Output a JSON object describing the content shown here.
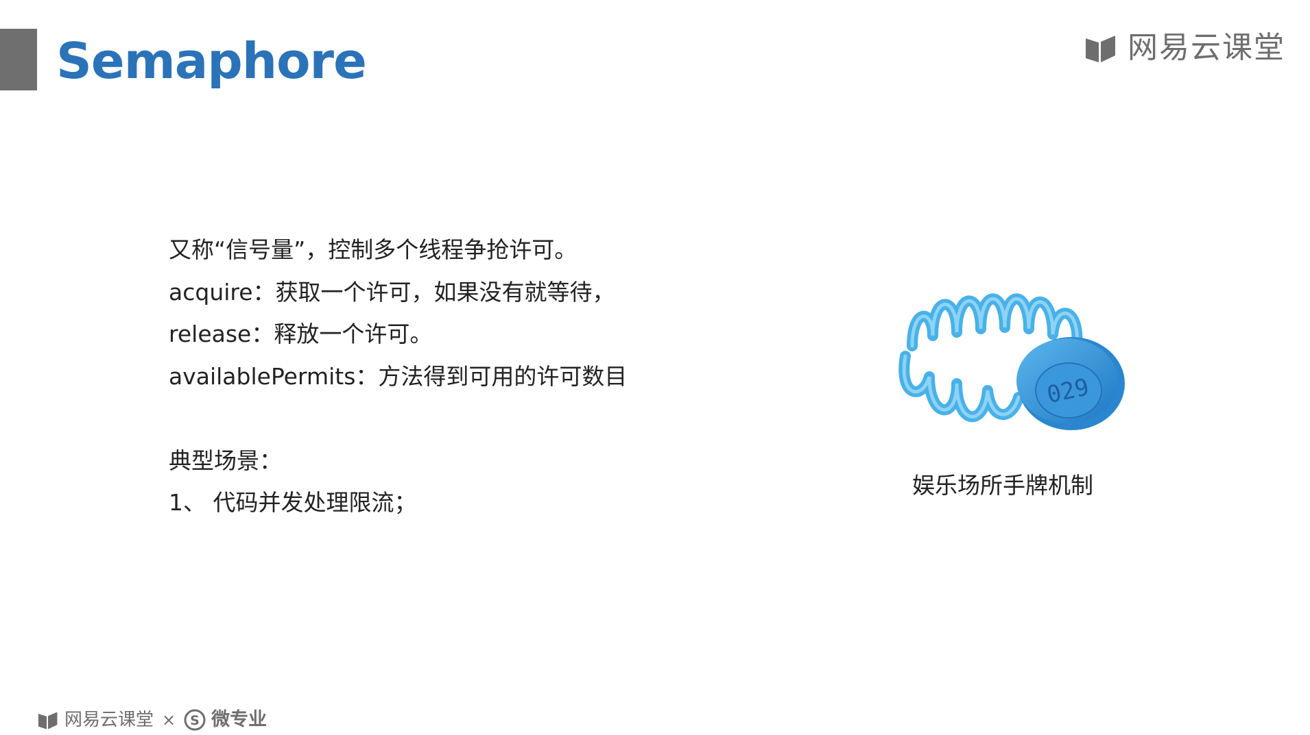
{
  "slide": {
    "title": "Semaphore"
  },
  "brand": {
    "top_text": "网易云课堂",
    "footer_text": "网易云课堂",
    "footer_separator": "×",
    "footer_micro_text": "微专业",
    "footer_micro_badge": "S",
    "icon": "book-logo-icon"
  },
  "content": {
    "lines": [
      "又称“信号量”，控制多个线程争抢许可。",
      "acquire：获取一个许可，如果没有就等待，",
      "release：释放一个许可。",
      "availablePermits：方法得到可用的许可数目"
    ],
    "scenario_heading": "典型场景：",
    "scenario_items": [
      "1、 代码并发处理限流；"
    ]
  },
  "image": {
    "tag_number": "029",
    "caption": "娱乐场所手牌机制",
    "colors": {
      "band": "#35a9e6",
      "band_light": "#7fd0f5",
      "tag": "#2f8fd6"
    }
  },
  "colors": {
    "title": "#2b73b8",
    "accent_bar": "#6f6f6f",
    "brand_gray": "#6e6e6e"
  }
}
